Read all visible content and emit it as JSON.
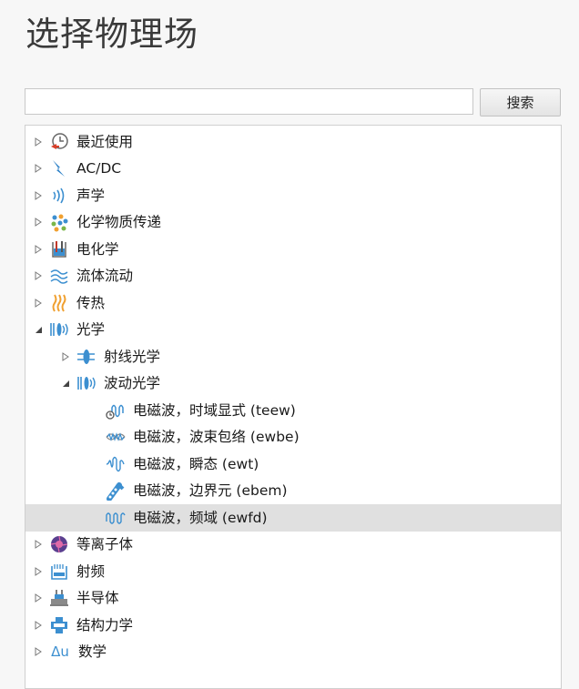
{
  "page": {
    "title": "选择物理场"
  },
  "search": {
    "placeholder": "",
    "value": "",
    "button_label": "搜索"
  },
  "tree": {
    "items": [
      {
        "label": "最近使用",
        "icon": "clock-icon"
      },
      {
        "label": "AC/DC",
        "icon": "lightning-icon"
      },
      {
        "label": "声学",
        "icon": "sound-wave-icon"
      },
      {
        "label": "化学物质传递",
        "icon": "particles-icon"
      },
      {
        "label": "电化学",
        "icon": "beaker-icon"
      },
      {
        "label": "流体流动",
        "icon": "flow-icon"
      },
      {
        "label": "传热",
        "icon": "heat-icon"
      },
      {
        "label": "光学",
        "icon": "optics-icon",
        "expanded": true
      },
      {
        "label": "射线光学",
        "icon": "lens-ray-icon"
      },
      {
        "label": "波动光学",
        "icon": "optics-icon",
        "expanded": true
      },
      {
        "label": "电磁波，时域显式 (teew)",
        "icon": "time-wave-icon"
      },
      {
        "label": "电磁波，波束包络 (ewbe)",
        "icon": "beam-envelope-icon"
      },
      {
        "label": "电磁波，瞬态 (ewt)",
        "icon": "transient-wave-icon"
      },
      {
        "label": "电磁波，边界元 (ebem)",
        "icon": "boundary-element-icon"
      },
      {
        "label": "电磁波，频域 (ewfd)",
        "icon": "frequency-wave-icon",
        "selected": true
      },
      {
        "label": "等离子体",
        "icon": "plasma-icon"
      },
      {
        "label": "射频",
        "icon": "antenna-icon"
      },
      {
        "label": "半导体",
        "icon": "semiconductor-icon"
      },
      {
        "label": "结构力学",
        "icon": "structure-icon"
      },
      {
        "label": "数学",
        "icon": "math-icon",
        "icon_text": "Δu"
      }
    ]
  },
  "colors": {
    "accent_blue": "#3c8fd0",
    "heat_orange": "#f0a030",
    "clock_red": "#d9402a",
    "selected_row": "#e0e0e0"
  }
}
